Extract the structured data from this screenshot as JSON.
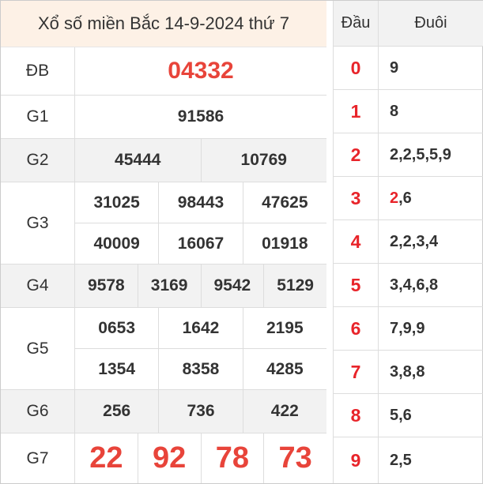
{
  "title": "Xổ số miền Bắc 14-9-2024 thứ 7",
  "prizes": [
    {
      "label": "ĐB",
      "rows": [
        [
          "04332"
        ]
      ]
    },
    {
      "label": "G1",
      "rows": [
        [
          "91586"
        ]
      ]
    },
    {
      "label": "G2",
      "rows": [
        [
          "45444",
          "10769"
        ]
      ]
    },
    {
      "label": "G3",
      "rows": [
        [
          "31025",
          "98443",
          "47625"
        ],
        [
          "40009",
          "16067",
          "01918"
        ]
      ]
    },
    {
      "label": "G4",
      "rows": [
        [
          "9578",
          "3169",
          "9542",
          "5129"
        ]
      ]
    },
    {
      "label": "G5",
      "rows": [
        [
          "0653",
          "1642",
          "2195"
        ],
        [
          "1354",
          "8358",
          "4285"
        ]
      ]
    },
    {
      "label": "G6",
      "rows": [
        [
          "256",
          "736",
          "422"
        ]
      ]
    },
    {
      "label": "G7",
      "rows": [
        [
          "22",
          "92",
          "78",
          "73"
        ]
      ]
    }
  ],
  "loto": {
    "header_dau": "Đầu",
    "header_duoi": "Đuôi",
    "rows": [
      {
        "dau": "0",
        "duoi": "9"
      },
      {
        "dau": "1",
        "duoi": "8"
      },
      {
        "dau": "2",
        "duoi": "2,2,5,5,9"
      },
      {
        "dau": "3",
        "duoi_hl": "2",
        "duoi_rest": ",6"
      },
      {
        "dau": "4",
        "duoi": "2,2,3,4"
      },
      {
        "dau": "5",
        "duoi": "3,4,6,8"
      },
      {
        "dau": "6",
        "duoi": "7,9,9"
      },
      {
        "dau": "7",
        "duoi": "3,8,8"
      },
      {
        "dau": "8",
        "duoi": "5,6"
      },
      {
        "dau": "9",
        "duoi": "2,5"
      }
    ]
  },
  "colors": {
    "red": "#e8443a",
    "header_bg": "#fdf1e6",
    "alt_row_bg": "#f2f2f2"
  }
}
